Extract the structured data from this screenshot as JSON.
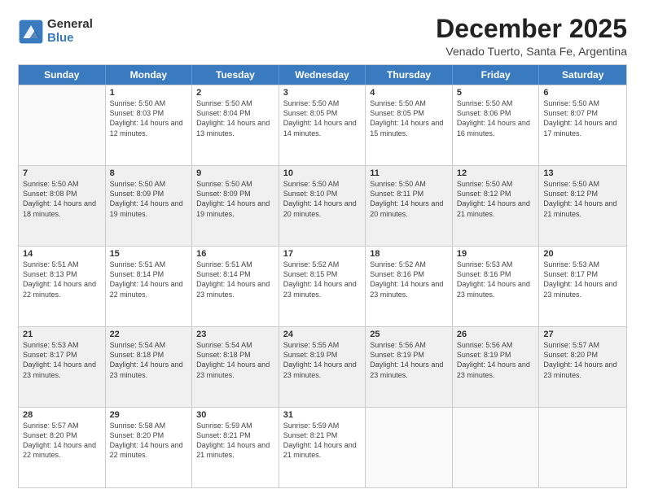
{
  "logo": {
    "general": "General",
    "blue": "Blue"
  },
  "title": "December 2025",
  "location": "Venado Tuerto, Santa Fe, Argentina",
  "header": {
    "days": [
      "Sunday",
      "Monday",
      "Tuesday",
      "Wednesday",
      "Thursday",
      "Friday",
      "Saturday"
    ]
  },
  "weeks": [
    [
      {
        "day": "",
        "empty": true
      },
      {
        "day": "1",
        "sunrise": "Sunrise: 5:50 AM",
        "sunset": "Sunset: 8:03 PM",
        "daylight": "Daylight: 14 hours and 12 minutes."
      },
      {
        "day": "2",
        "sunrise": "Sunrise: 5:50 AM",
        "sunset": "Sunset: 8:04 PM",
        "daylight": "Daylight: 14 hours and 13 minutes."
      },
      {
        "day": "3",
        "sunrise": "Sunrise: 5:50 AM",
        "sunset": "Sunset: 8:05 PM",
        "daylight": "Daylight: 14 hours and 14 minutes."
      },
      {
        "day": "4",
        "sunrise": "Sunrise: 5:50 AM",
        "sunset": "Sunset: 8:05 PM",
        "daylight": "Daylight: 14 hours and 15 minutes."
      },
      {
        "day": "5",
        "sunrise": "Sunrise: 5:50 AM",
        "sunset": "Sunset: 8:06 PM",
        "daylight": "Daylight: 14 hours and 16 minutes."
      },
      {
        "day": "6",
        "sunrise": "Sunrise: 5:50 AM",
        "sunset": "Sunset: 8:07 PM",
        "daylight": "Daylight: 14 hours and 17 minutes."
      }
    ],
    [
      {
        "day": "7",
        "sunrise": "Sunrise: 5:50 AM",
        "sunset": "Sunset: 8:08 PM",
        "daylight": "Daylight: 14 hours and 18 minutes."
      },
      {
        "day": "8",
        "sunrise": "Sunrise: 5:50 AM",
        "sunset": "Sunset: 8:09 PM",
        "daylight": "Daylight: 14 hours and 19 minutes."
      },
      {
        "day": "9",
        "sunrise": "Sunrise: 5:50 AM",
        "sunset": "Sunset: 8:09 PM",
        "daylight": "Daylight: 14 hours and 19 minutes."
      },
      {
        "day": "10",
        "sunrise": "Sunrise: 5:50 AM",
        "sunset": "Sunset: 8:10 PM",
        "daylight": "Daylight: 14 hours and 20 minutes."
      },
      {
        "day": "11",
        "sunrise": "Sunrise: 5:50 AM",
        "sunset": "Sunset: 8:11 PM",
        "daylight": "Daylight: 14 hours and 20 minutes."
      },
      {
        "day": "12",
        "sunrise": "Sunrise: 5:50 AM",
        "sunset": "Sunset: 8:12 PM",
        "daylight": "Daylight: 14 hours and 21 minutes."
      },
      {
        "day": "13",
        "sunrise": "Sunrise: 5:50 AM",
        "sunset": "Sunset: 8:12 PM",
        "daylight": "Daylight: 14 hours and 21 minutes."
      }
    ],
    [
      {
        "day": "14",
        "sunrise": "Sunrise: 5:51 AM",
        "sunset": "Sunset: 8:13 PM",
        "daylight": "Daylight: 14 hours and 22 minutes."
      },
      {
        "day": "15",
        "sunrise": "Sunrise: 5:51 AM",
        "sunset": "Sunset: 8:14 PM",
        "daylight": "Daylight: 14 hours and 22 minutes."
      },
      {
        "day": "16",
        "sunrise": "Sunrise: 5:51 AM",
        "sunset": "Sunset: 8:14 PM",
        "daylight": "Daylight: 14 hours and 23 minutes."
      },
      {
        "day": "17",
        "sunrise": "Sunrise: 5:52 AM",
        "sunset": "Sunset: 8:15 PM",
        "daylight": "Daylight: 14 hours and 23 minutes."
      },
      {
        "day": "18",
        "sunrise": "Sunrise: 5:52 AM",
        "sunset": "Sunset: 8:16 PM",
        "daylight": "Daylight: 14 hours and 23 minutes."
      },
      {
        "day": "19",
        "sunrise": "Sunrise: 5:53 AM",
        "sunset": "Sunset: 8:16 PM",
        "daylight": "Daylight: 14 hours and 23 minutes."
      },
      {
        "day": "20",
        "sunrise": "Sunrise: 5:53 AM",
        "sunset": "Sunset: 8:17 PM",
        "daylight": "Daylight: 14 hours and 23 minutes."
      }
    ],
    [
      {
        "day": "21",
        "sunrise": "Sunrise: 5:53 AM",
        "sunset": "Sunset: 8:17 PM",
        "daylight": "Daylight: 14 hours and 23 minutes."
      },
      {
        "day": "22",
        "sunrise": "Sunrise: 5:54 AM",
        "sunset": "Sunset: 8:18 PM",
        "daylight": "Daylight: 14 hours and 23 minutes."
      },
      {
        "day": "23",
        "sunrise": "Sunrise: 5:54 AM",
        "sunset": "Sunset: 8:18 PM",
        "daylight": "Daylight: 14 hours and 23 minutes."
      },
      {
        "day": "24",
        "sunrise": "Sunrise: 5:55 AM",
        "sunset": "Sunset: 8:19 PM",
        "daylight": "Daylight: 14 hours and 23 minutes."
      },
      {
        "day": "25",
        "sunrise": "Sunrise: 5:56 AM",
        "sunset": "Sunset: 8:19 PM",
        "daylight": "Daylight: 14 hours and 23 minutes."
      },
      {
        "day": "26",
        "sunrise": "Sunrise: 5:56 AM",
        "sunset": "Sunset: 8:19 PM",
        "daylight": "Daylight: 14 hours and 23 minutes."
      },
      {
        "day": "27",
        "sunrise": "Sunrise: 5:57 AM",
        "sunset": "Sunset: 8:20 PM",
        "daylight": "Daylight: 14 hours and 23 minutes."
      }
    ],
    [
      {
        "day": "28",
        "sunrise": "Sunrise: 5:57 AM",
        "sunset": "Sunset: 8:20 PM",
        "daylight": "Daylight: 14 hours and 22 minutes."
      },
      {
        "day": "29",
        "sunrise": "Sunrise: 5:58 AM",
        "sunset": "Sunset: 8:20 PM",
        "daylight": "Daylight: 14 hours and 22 minutes."
      },
      {
        "day": "30",
        "sunrise": "Sunrise: 5:59 AM",
        "sunset": "Sunset: 8:21 PM",
        "daylight": "Daylight: 14 hours and 21 minutes."
      },
      {
        "day": "31",
        "sunrise": "Sunrise: 5:59 AM",
        "sunset": "Sunset: 8:21 PM",
        "daylight": "Daylight: 14 hours and 21 minutes."
      },
      {
        "day": "",
        "empty": true
      },
      {
        "day": "",
        "empty": true
      },
      {
        "day": "",
        "empty": true
      }
    ]
  ]
}
